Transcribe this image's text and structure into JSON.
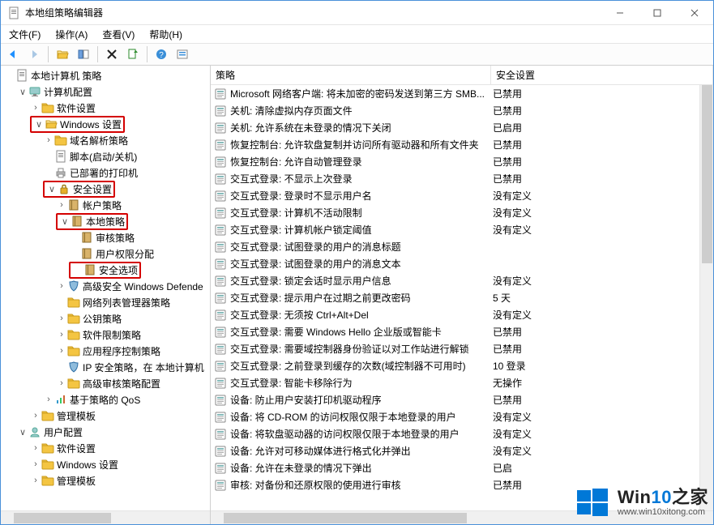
{
  "title": "本地组策略编辑器",
  "menu": {
    "file": "文件(F)",
    "action": "操作(A)",
    "view": "查看(V)",
    "help": "帮助(H)"
  },
  "columns": {
    "policy": "策略",
    "setting": "安全设置"
  },
  "tree": {
    "root": "本地计算机 策略",
    "computer_config": "计算机配置",
    "software_settings": "软件设置",
    "windows_settings": "Windows 设置",
    "dns_policy": "域名解析策略",
    "scripts": "脚本(启动/关机)",
    "deployed_printers": "已部署的打印机",
    "security_settings": "安全设置",
    "account_policies": "帐户策略",
    "local_policies": "本地策略",
    "audit_policy": "审核策略",
    "user_rights": "用户权限分配",
    "security_options": "安全选项",
    "defender": "高级安全 Windows Defende",
    "network_list": "网络列表管理器策略",
    "pubkey": "公钥策略",
    "software_restrict": "软件限制策略",
    "app_control": "应用程序控制策略",
    "ipsec": "IP 安全策略，在 本地计算机",
    "adv_audit": "高级审核策略配置",
    "qos": "基于策略的 QoS",
    "admin_templates": "管理模板",
    "user_config": "用户配置",
    "u_software": "软件设置",
    "u_windows": "Windows 设置",
    "u_admin": "管理模板"
  },
  "policies": [
    {
      "name": "Microsoft 网络客户端: 将未加密的密码发送到第三方 SMB...",
      "value": "已禁用"
    },
    {
      "name": "关机: 清除虚拟内存页面文件",
      "value": "已禁用"
    },
    {
      "name": "关机: 允许系统在未登录的情况下关闭",
      "value": "已启用"
    },
    {
      "name": "恢复控制台: 允许软盘复制并访问所有驱动器和所有文件夹",
      "value": "已禁用"
    },
    {
      "name": "恢复控制台: 允许自动管理登录",
      "value": "已禁用"
    },
    {
      "name": "交互式登录: 不显示上次登录",
      "value": "已禁用"
    },
    {
      "name": "交互式登录: 登录时不显示用户名",
      "value": "没有定义"
    },
    {
      "name": "交互式登录: 计算机不活动限制",
      "value": "没有定义"
    },
    {
      "name": "交互式登录: 计算机帐户锁定阈值",
      "value": "没有定义"
    },
    {
      "name": "交互式登录: 试图登录的用户的消息标题",
      "value": ""
    },
    {
      "name": "交互式登录: 试图登录的用户的消息文本",
      "value": ""
    },
    {
      "name": "交互式登录: 锁定会话时显示用户信息",
      "value": "没有定义"
    },
    {
      "name": "交互式登录: 提示用户在过期之前更改密码",
      "value": "5 天"
    },
    {
      "name": "交互式登录: 无须按 Ctrl+Alt+Del",
      "value": "没有定义"
    },
    {
      "name": "交互式登录: 需要 Windows Hello 企业版或智能卡",
      "value": "已禁用"
    },
    {
      "name": "交互式登录: 需要域控制器身份验证以对工作站进行解锁",
      "value": "已禁用"
    },
    {
      "name": "交互式登录: 之前登录到缓存的次数(域控制器不可用时)",
      "value": "10 登录"
    },
    {
      "name": "交互式登录: 智能卡移除行为",
      "value": "无操作"
    },
    {
      "name": "设备: 防止用户安装打印机驱动程序",
      "value": "已禁用"
    },
    {
      "name": "设备: 将 CD-ROM 的访问权限仅限于本地登录的用户",
      "value": "没有定义"
    },
    {
      "name": "设备: 将软盘驱动器的访问权限仅限于本地登录的用户",
      "value": "没有定义"
    },
    {
      "name": "设备: 允许对可移动媒体进行格式化并弹出",
      "value": "没有定义"
    },
    {
      "name": "设备: 允许在未登录的情况下弹出",
      "value": "已启"
    },
    {
      "name": "审核: 对备份和还原权限的使用进行审核",
      "value": "已禁用"
    }
  ],
  "watermark": {
    "big_a": "Win",
    "big_b": "10",
    "big_c": "之家",
    "url": "www.win10xitong.com"
  }
}
